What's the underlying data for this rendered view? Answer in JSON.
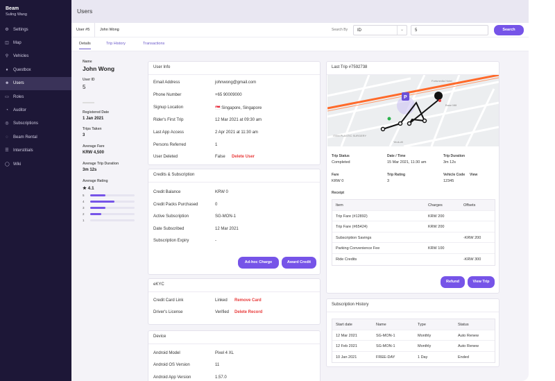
{
  "app": {
    "name": "Beam",
    "user": "Suling Wang"
  },
  "nav": [
    {
      "label": "Settings",
      "icon": "gear-icon",
      "glyph": "⚙"
    },
    {
      "label": "Map",
      "icon": "map-icon",
      "glyph": "◫"
    },
    {
      "label": "Vehicles",
      "icon": "scooter-icon",
      "glyph": "⚲"
    },
    {
      "label": "Questbox",
      "icon": "pin-icon",
      "glyph": "♦"
    },
    {
      "label": "Users",
      "icon": "users-icon",
      "glyph": "☻",
      "active": true
    },
    {
      "label": "Roles",
      "icon": "roles-icon",
      "glyph": "▭"
    },
    {
      "label": "Auditor",
      "icon": "auditor-icon",
      "glyph": "◔"
    },
    {
      "label": "Subscriptions",
      "icon": "subscriptions-icon",
      "glyph": "◎"
    },
    {
      "label": "Beam Rental",
      "icon": "rental-icon",
      "glyph": "◌"
    },
    {
      "label": "Interstitials",
      "icon": "interstitials-icon",
      "glyph": "☰"
    },
    {
      "label": "Wiki",
      "icon": "wiki-icon",
      "glyph": "◯"
    }
  ],
  "page_title": "Users",
  "breadcrumb": {
    "id": "User #5",
    "name": "John Wong"
  },
  "search": {
    "label": "Search By",
    "field": "ID",
    "value": "5",
    "button": "Search"
  },
  "tabs": [
    "Details",
    "Trip History",
    "Transactions"
  ],
  "profile": {
    "name_label": "Name",
    "name": "John Wong",
    "id_label": "User ID",
    "id": "5",
    "reg_label": "Registered Date",
    "reg": "1 Jan 2021",
    "trips_label": "Trips Taken",
    "trips": "3",
    "fare_label": "Average Fare",
    "fare": "KRW 4,500",
    "dur_label": "Average Trip Duration",
    "dur": "3m 12s",
    "rating_label": "Average Rating",
    "rating": "4.1",
    "rating_bars": [
      {
        "star": "5",
        "frac": 0.35
      },
      {
        "star": "4",
        "frac": 0.55
      },
      {
        "star": "3",
        "frac": 0.35
      },
      {
        "star": "2",
        "frac": 0.25
      },
      {
        "star": "1",
        "frac": 0
      }
    ]
  },
  "user_info": {
    "title": "User Info",
    "rows": [
      {
        "label": "Email Address",
        "value": "johnwong@gmail.com"
      },
      {
        "label": "Phone Number",
        "value": "+65 90009000"
      },
      {
        "label": "Signup Location",
        "value": "🇸🇬 Singapore, Singapore"
      },
      {
        "label": "Rider's First Trip",
        "value": "12 Mar 2021 at 09:30 am"
      },
      {
        "label": "Last App Access",
        "value": "2 Apr 2021 at 11:30 am"
      },
      {
        "label": "Persons Referred",
        "value": "1"
      },
      {
        "label": "User Deleted",
        "value": "False",
        "action": "Delete User"
      }
    ]
  },
  "credits": {
    "title": "Credits & Subscription",
    "rows": [
      {
        "label": "Credit Balance",
        "value": "KRW 0"
      },
      {
        "label": "Credit Packs Purchased",
        "value": "0"
      },
      {
        "label": "Active Subscription",
        "value": "SG-MON-1"
      },
      {
        "label": "Date Subscribed",
        "value": "12 Mar 2021"
      },
      {
        "label": "Subscription Expiry",
        "value": "-"
      }
    ],
    "btn_adhoc": "Ad-hoc Charge",
    "btn_award": "Award Credit"
  },
  "ekyc": {
    "title": "eKYC",
    "rows": [
      {
        "label": "Credit Card Link",
        "value": "Linked",
        "action": "Remove Card"
      },
      {
        "label": "Driver's License",
        "value": "Verified",
        "action": "Delete Record"
      }
    ]
  },
  "device": {
    "title": "Device",
    "rows": [
      {
        "label": "Android Model",
        "value": "Pixel 4 XL"
      },
      {
        "label": "Android OS Version",
        "value": "11"
      },
      {
        "label": "Android App Version",
        "value": "1.57.0"
      }
    ]
  },
  "last_trip": {
    "title": "Last Trip #7592738",
    "map_labels": {
      "a": "Fortunedia Hotel",
      "b": "ITEM PLASTIC SURGERY",
      "c": "Yeok-rill",
      "d": "Base Mill"
    },
    "stats": [
      {
        "label": "Trip Status",
        "value": "Completed"
      },
      {
        "label": "Date / Time",
        "value": "15 Mar 2021, 11:30 am"
      },
      {
        "label": "Trip Duration",
        "value": "3m 12s"
      },
      {
        "label": "Fare",
        "value": "KRW 0"
      },
      {
        "label": "Trip Rating",
        "value": "3"
      },
      {
        "label": "Vehicle Code",
        "value": "12345",
        "link": "View"
      }
    ],
    "receipt_label": "Receipt",
    "receipt_headers": [
      "Item",
      "Charges",
      "Offsets"
    ],
    "receipt_rows": [
      [
        "Trip Fare (#12892)",
        "KRW 200",
        ""
      ],
      [
        "Trip Fare (#65424)",
        "KRW 200",
        ""
      ],
      [
        "Subscription Savings",
        "",
        "-KRW 200"
      ],
      [
        "Parking Convenience Fee",
        "KRW 100",
        ""
      ],
      [
        "Ride Credits",
        "",
        "-KRW 300"
      ]
    ],
    "btn_refund": "Refund",
    "btn_view": "View Trip"
  },
  "sub_history": {
    "title": "Subscription History",
    "headers": [
      "Start date",
      "Name",
      "Type",
      "Status"
    ],
    "rows": [
      [
        "12 Mar 2021",
        "SG-MON-1",
        "Monthly",
        "Auto Renew"
      ],
      [
        "12 Feb 2021",
        "SG-MON-1",
        "Monthly",
        "Auto Renew"
      ],
      [
        "10 Jan 2021",
        "FREE-DAY",
        "1 Day",
        "Ended"
      ]
    ]
  },
  "colors": {
    "accent": "#7654e8",
    "sidebar": "#1d1737",
    "danger": "#e83a3a"
  }
}
